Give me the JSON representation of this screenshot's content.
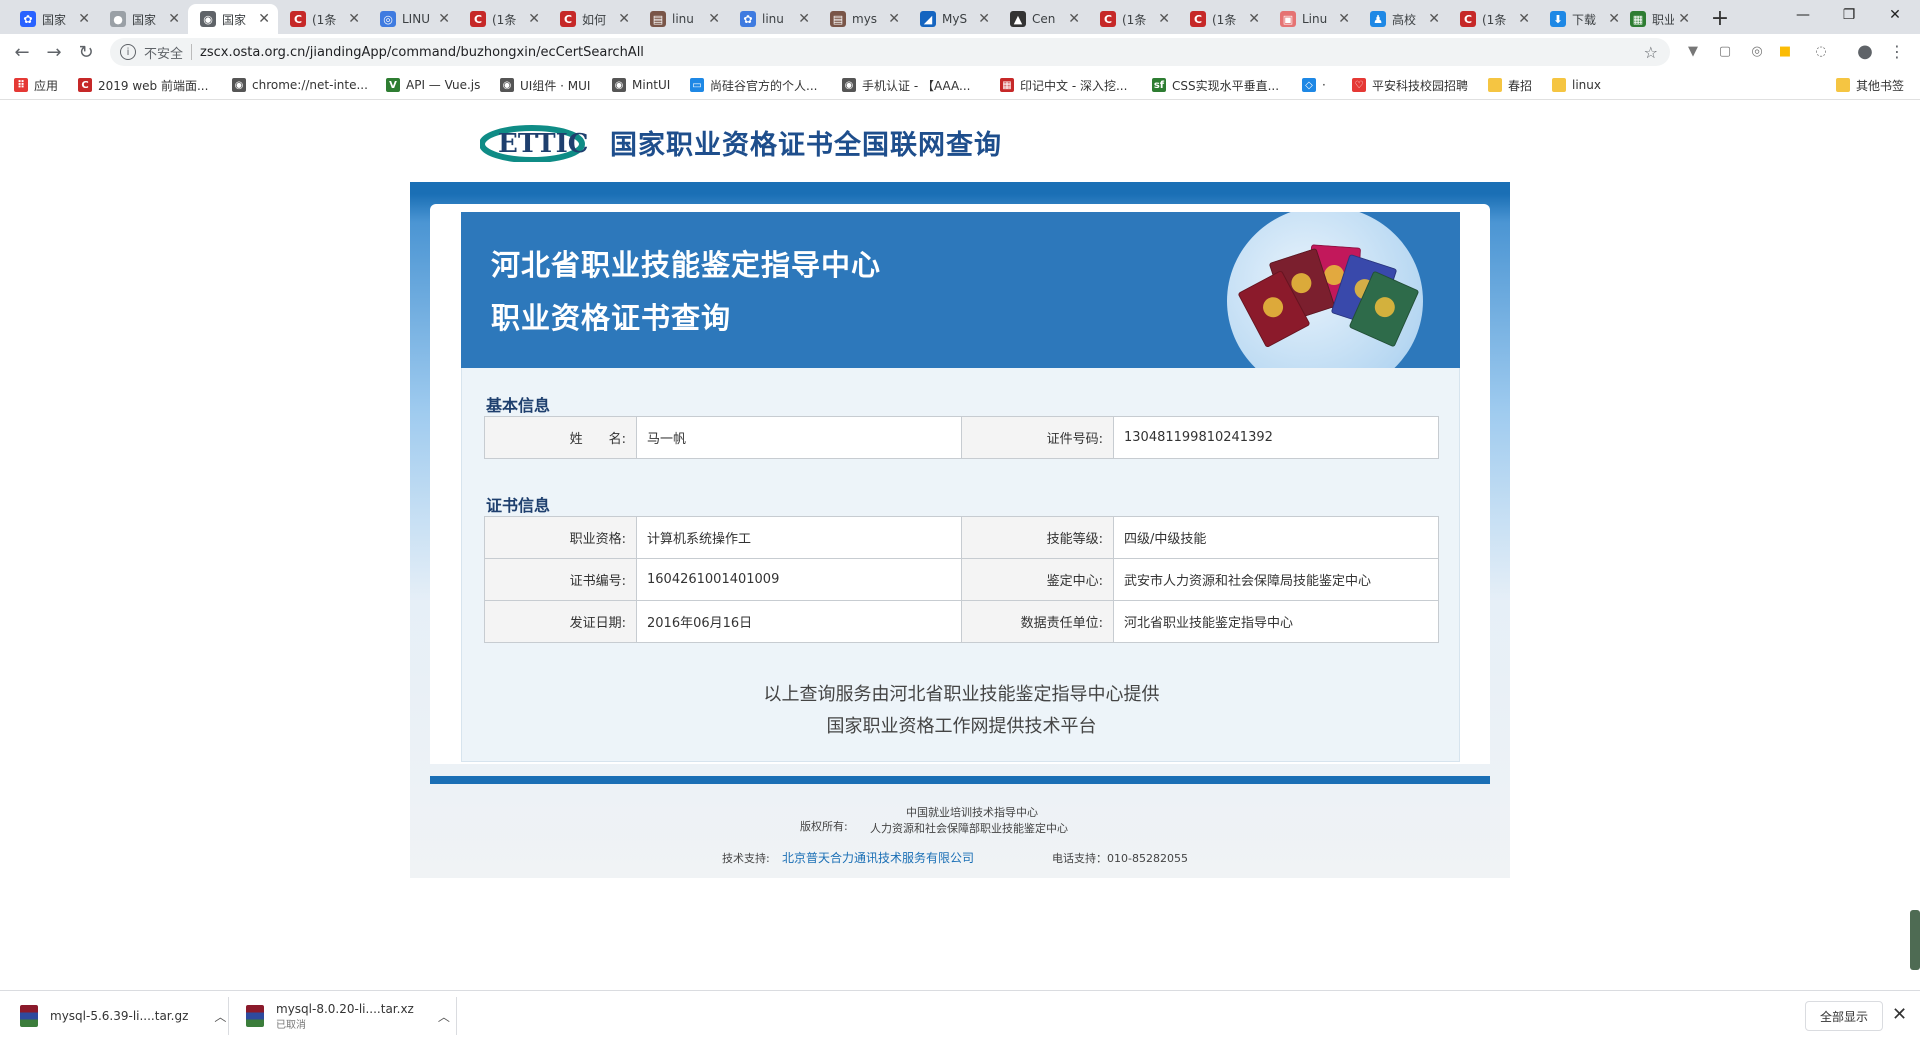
{
  "browser": {
    "tabs": [
      {
        "label": "国家",
        "color": "#2962ff",
        "glyph": "✿"
      },
      {
        "label": "国家",
        "color": "#9aa0a6",
        "glyph": "●"
      },
      {
        "label": "国家",
        "color": "#5f6368",
        "glyph": "◉",
        "active": true
      },
      {
        "label": "(1条",
        "color": "#c62828",
        "glyph": "C"
      },
      {
        "label": "LINU",
        "color": "#3f7be0",
        "glyph": "◎"
      },
      {
        "label": "(1条",
        "color": "#c62828",
        "glyph": "C"
      },
      {
        "label": "如何",
        "color": "#c62828",
        "glyph": "C"
      },
      {
        "label": "linu",
        "color": "#795548",
        "glyph": "▤"
      },
      {
        "label": "linu",
        "color": "#3f7be0",
        "glyph": "✿"
      },
      {
        "label": "mys",
        "color": "#795548",
        "glyph": "▤"
      },
      {
        "label": "MyS",
        "color": "#1565c0",
        "glyph": "◢"
      },
      {
        "label": "Cen",
        "color": "#333333",
        "glyph": "▲"
      },
      {
        "label": "(1条",
        "color": "#c62828",
        "glyph": "C"
      },
      {
        "label": "(1条",
        "color": "#c62828",
        "glyph": "C"
      },
      {
        "label": "Linu",
        "color": "#e57373",
        "glyph": "▣"
      },
      {
        "label": "高校",
        "color": "#1e88e5",
        "glyph": "♟"
      },
      {
        "label": "(1条",
        "color": "#c62828",
        "glyph": "C"
      },
      {
        "label": "下载",
        "color": "#1e88e5",
        "glyph": "⬇"
      },
      {
        "label": "职业",
        "color": "#2e7d32",
        "glyph": "▦"
      }
    ],
    "new_tab": "+",
    "window_controls": [
      "—",
      "❐",
      "✕"
    ],
    "address": {
      "security": "不安全",
      "url": "zscx.osta.org.cn/jiandingApp/command/buzhongxin/ecCertSearchAll"
    },
    "bookmarks": [
      {
        "label": "应用",
        "color": "#e53935",
        "glyph": "⠿"
      },
      {
        "label": "2019 web 前端面...",
        "color": "#c62828",
        "glyph": "C"
      },
      {
        "label": "chrome://net-inte...",
        "color": "#555555",
        "glyph": "◉"
      },
      {
        "label": "API — Vue.js",
        "color": "#2e7d32",
        "glyph": "V"
      },
      {
        "label": "UI组件 · MUI",
        "color": "#555555",
        "glyph": "◉"
      },
      {
        "label": "MintUI",
        "color": "#555555",
        "glyph": "◉"
      },
      {
        "label": "尚硅谷官方的个人...",
        "color": "#1e88e5",
        "glyph": "▭"
      },
      {
        "label": "手机认证 - 【AAA...",
        "color": "#555555",
        "glyph": "◉"
      },
      {
        "label": "印记中文 - 深入挖...",
        "color": "#c62828",
        "glyph": "▦"
      },
      {
        "label": "CSS实现水平垂直...",
        "color": "#2e7d32",
        "glyph": "sf"
      },
      {
        "label": "·",
        "color": "#1e88e5",
        "glyph": "◇"
      },
      {
        "label": "平安科技校园招聘",
        "color": "#e53935",
        "glyph": "♡"
      },
      {
        "label": "春招",
        "color": "#f5c542",
        "glyph": ""
      },
      {
        "label": "linux",
        "color": "#f5c542",
        "glyph": ""
      }
    ],
    "other_bookmarks": "其他书签"
  },
  "page": {
    "logo_mark": "ETTIC",
    "site_title": "国家职业资格证书全国联网查询",
    "banner": {
      "line1": "河北省职业技能鉴定指导中心",
      "line2": "职业资格证书查询"
    },
    "basic_section": "基本信息",
    "basic": {
      "name_label": "姓　　名:",
      "name_value": "马一帆",
      "id_label": "证件号码:",
      "id_value": "130481199810241392"
    },
    "cert_section": "证书信息",
    "cert_rows": [
      {
        "l1": "职业资格:",
        "v1": "计算机系统操作工",
        "l2": "技能等级:",
        "v2": "四级/中级技能"
      },
      {
        "l1": "证书编号:",
        "v1": "1604261001401009",
        "l2": "鉴定中心:",
        "v2": "武安市人力资源和社会保障局技能鉴定中心"
      },
      {
        "l1": "发证日期:",
        "v1": "2016年06月16日",
        "l2": "数据责任单位:",
        "v2": "河北省职业技能鉴定指导中心"
      }
    ],
    "service_note1": "以上查询服务由河北省职业技能鉴定指导中心提供",
    "service_note2": "国家职业资格工作网提供技术平台",
    "copyright": {
      "label": "版权所有:",
      "org1": "中国就业培训技术指导中心",
      "org2": "人力资源和社会保障部职业技能鉴定中心",
      "support_label": "技术支持:",
      "support_link": "北京普天合力通讯技术服务有限公司",
      "phone": "电话支持：010-85282055"
    }
  },
  "downloads": {
    "items": [
      {
        "name": "mysql-5.6.39-li....tar.gz",
        "status": ""
      },
      {
        "name": "mysql-8.0.20-li....tar.xz",
        "status": "已取消"
      }
    ],
    "show_all": "全部显示"
  }
}
